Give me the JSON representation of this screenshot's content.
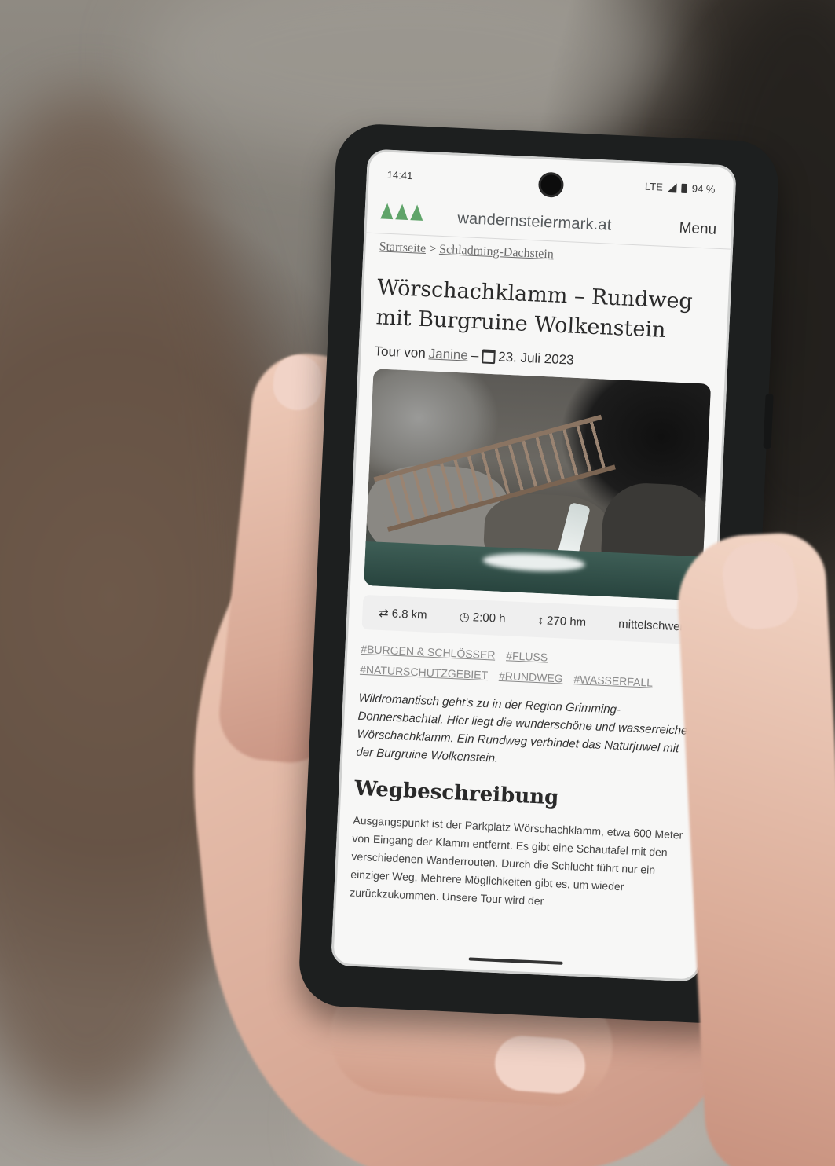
{
  "status_bar": {
    "time": "14:41",
    "network": "LTE",
    "battery": "94 %"
  },
  "header": {
    "site_name": "wandernsteiermark.at",
    "menu_label": "Menu",
    "logo_icon": "trees-logo-icon"
  },
  "breadcrumb": {
    "home": "Startseite",
    "separator": ">",
    "current": "Schladming-Dachstein"
  },
  "article": {
    "title": "Wörschachklamm – Rundweg mit Burgruine Wolkenstein",
    "author_prefix": "Tour von",
    "author": "Janine",
    "date_separator": "–",
    "date": "23. Juli 2023",
    "stats": {
      "distance": "6.8 km",
      "duration": "2:00 h",
      "elevation": "270 hm",
      "difficulty": "mittelschwer"
    },
    "tags": [
      "#BURGEN & SCHLÖSSER",
      "#FLUSS",
      "#NATURSCHUTZGEBIET",
      "#RUNDWEG",
      "#WASSERFALL"
    ],
    "lead": "Wildromantisch geht's zu in der Region Grimming-Donnersbachtal. Hier liegt die wunderschöne und wasserreiche Wörschachklamm. Ein Rundweg verbindet das Naturjuwel mit der Burgruine Wolkenstein.",
    "section_title": "Wegbeschreibung",
    "section_text": "Ausgangspunkt ist der Parkplatz Wörschachklamm, etwa 600 Meter von Eingang der Klamm entfernt. Es gibt eine Schautafel mit den verschiedenen Wanderrouten. Durch die Schlucht führt nur ein einziger Weg. Mehrere Möglichkeiten gibt es, um wieder zurückzukommen. Unsere Tour wird der"
  }
}
